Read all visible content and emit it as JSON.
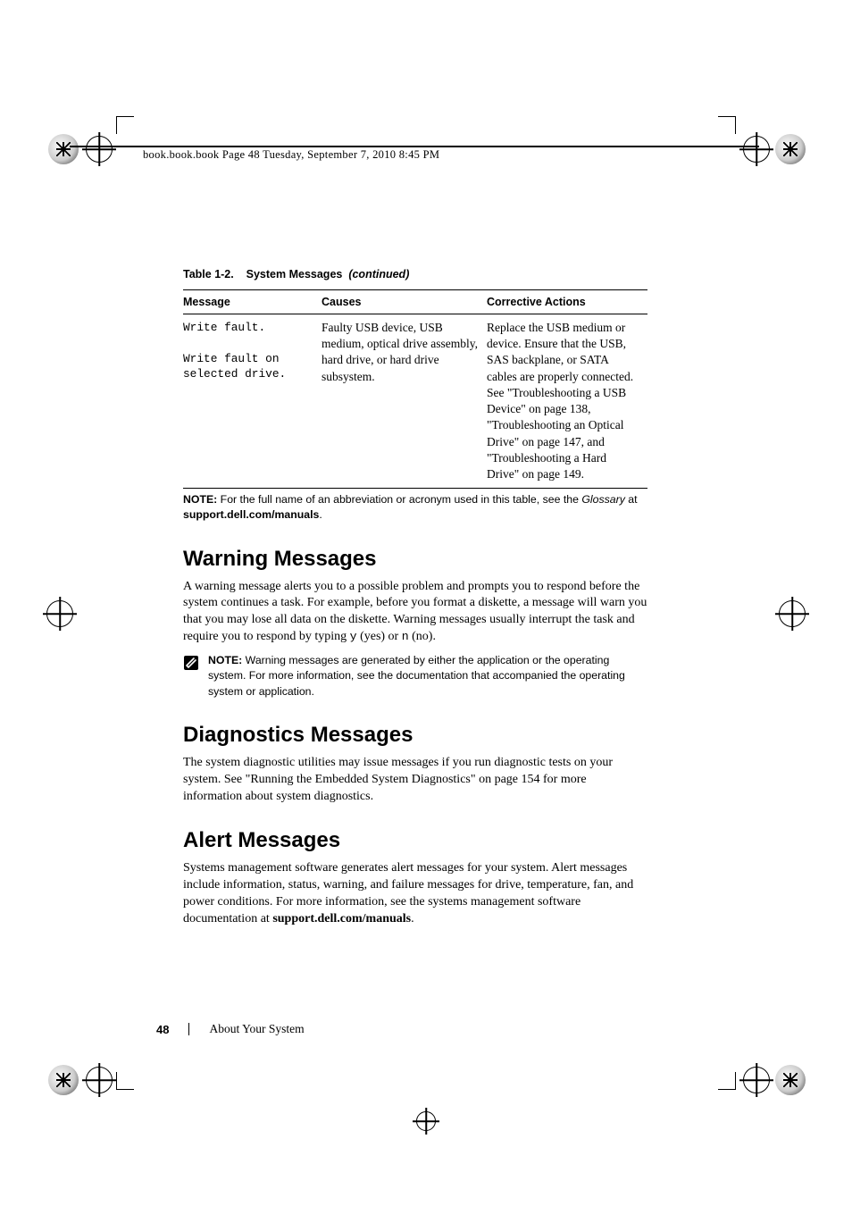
{
  "header_runner": "book.book.book  Page 48  Tuesday, September 7, 2010  8:45 PM",
  "table": {
    "caption_prefix": "Table 1-2.",
    "caption_title": "System Messages",
    "caption_suffix": "(continued)",
    "headers": [
      "Message",
      "Causes",
      "Corrective Actions"
    ],
    "row": {
      "message": "Write fault.\n\nWrite fault on selected drive.",
      "causes": "Faulty USB device, USB medium, optical drive assembly, hard drive, or hard drive subsystem.",
      "corrective": "Replace the USB medium or device. Ensure that the USB, SAS backplane, or SATA cables are properly connected.\nSee \"Troubleshooting a USB Device\" on page 138, \"Troubleshooting an Optical Drive\" on page 147, and \"Troubleshooting a Hard Drive\" on page 149."
    },
    "footnote_bold": "NOTE:",
    "footnote_rest": " For the full name of an abbreviation or acronym used in this table, see the ",
    "footnote_ital": "Glossary",
    "footnote_tail_pre": " at ",
    "footnote_tail_bold": "support.dell.com/manuals",
    "footnote_tail_post": "."
  },
  "sections": {
    "warning": {
      "title": "Warning Messages",
      "body_pre": "A warning message alerts you to a possible problem and prompts you to respond before the system continues a task. For example, before you format a diskette, a message will warn you that you may lose all data on the diskette. Warning messages usually interrupt the task and require you to respond by typing ",
      "mono_y": "y",
      "body_mid1": " (yes) or ",
      "mono_n": "n",
      "body_post": " (no).",
      "note_label": "NOTE: ",
      "note_body": "Warning messages are generated by either the application or the operating system. For more information, see the documentation that accompanied the operating system or application."
    },
    "diagnostics": {
      "title": "Diagnostics Messages",
      "body": "The system diagnostic utilities may issue messages if you run diagnostic tests on your system. See \"Running the Embedded System Diagnostics\" on page 154 for more information about system diagnostics."
    },
    "alert": {
      "title": "Alert Messages",
      "body_pre": "Systems management software generates alert messages for your system. Alert messages include information, status, warning, and failure messages for drive, temperature, fan, and power conditions. For more information, see the systems management software documentation at ",
      "body_bold": "support.dell.com/manuals",
      "body_post": "."
    }
  },
  "footer": {
    "page_number": "48",
    "section_name": "About Your System"
  }
}
